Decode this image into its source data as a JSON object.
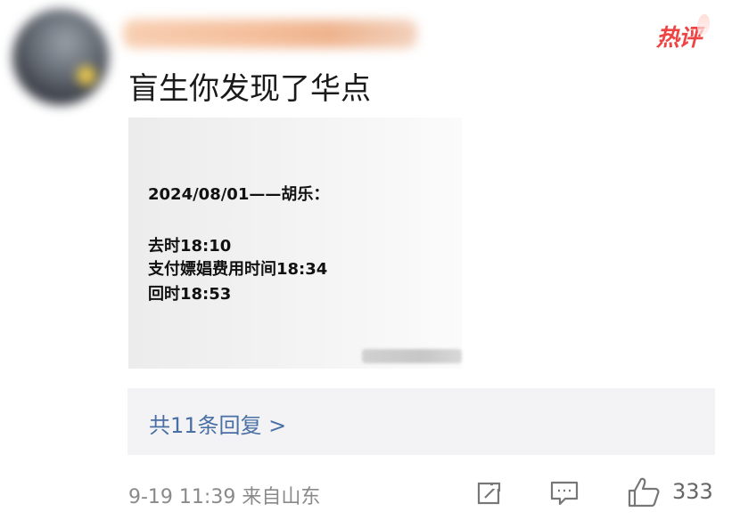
{
  "comment": {
    "hot_badge": "热评",
    "text": "盲生你发现了华点"
  },
  "image": {
    "lines": [
      "2024/08/01——胡乐：",
      "去时18:10",
      "支付嫖娼费用时间18:34",
      "回时18:53"
    ]
  },
  "replies": {
    "label": "共11条回复 >"
  },
  "footer": {
    "time_location": "9-19 11:39  来自山东",
    "like_count": "333"
  },
  "icons": [
    "share-icon",
    "comment-icon",
    "like-icon"
  ],
  "colors": {
    "hot": "#ee4444",
    "link": "#4a6fa5",
    "meta": "#8a8a8a"
  }
}
